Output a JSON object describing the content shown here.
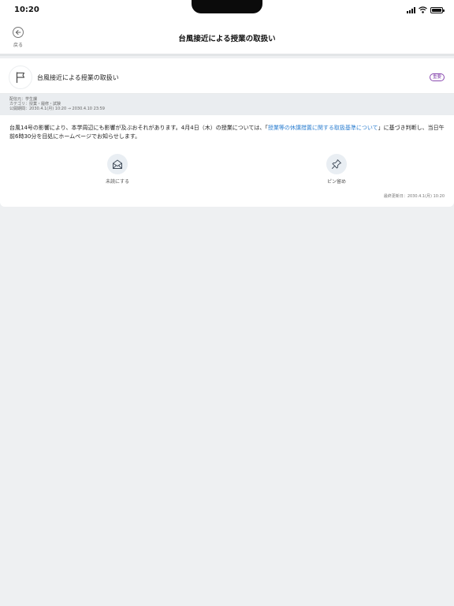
{
  "status_bar": {
    "time": "10:20"
  },
  "nav": {
    "back_label": "戻る",
    "title": "台風接近による授業の取扱い"
  },
  "notice": {
    "title": "台風接近による授業の取扱い",
    "badge": "重要",
    "badge_color": "#8a4bb0",
    "sender": "配信元：学生課",
    "category": "カテゴリ：授業・履修・試験",
    "period": "公開期間：2030.4.1(月) 10:20 → 2030.4.10 23:59",
    "body_part1": "台風14号の影響により、本学周辺にも影響が及ぶおそれがあります。4月4日（木）の授業については、「",
    "body_link": "授業等の休講措置に関する取扱基準について",
    "body_part2": "」に基づき判断し、当日午前6時30分を目処にホームページでお知らせします。",
    "link_color": "#2d7fd0",
    "actions": {
      "unread_label": "未読にする",
      "pin_label": "ピン留め"
    },
    "updated": "最終更新日：2030.4.1(月) 10:20"
  },
  "icons": {
    "back": "back-arrow-icon",
    "flag": "flag-icon",
    "unread": "envelope-open-icon",
    "pin": "pin-icon"
  }
}
